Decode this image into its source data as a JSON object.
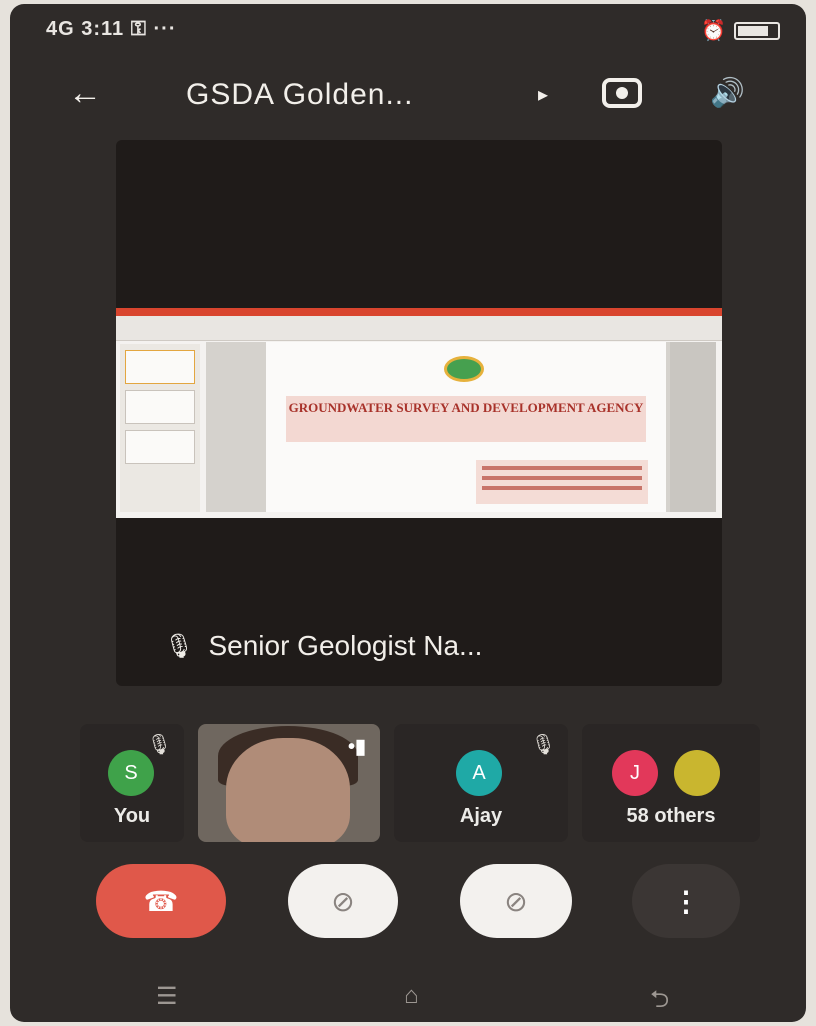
{
  "status_bar": {
    "left": "4G 3:11 ⚿  ···",
    "right_icon": "battery-icon"
  },
  "app_bar": {
    "back_icon": "back-arrow-icon",
    "title": "GSDA Golden...",
    "title_chevron": "▸",
    "switch_camera_icon": "switch-camera-icon",
    "speaker_icon": "speaker-icon"
  },
  "main_video": {
    "slide_heading": "GROUNDWATER SURVEY AND DEVELOPMENT AGENCY",
    "speaker_name": "Senior Geologist Na..."
  },
  "participants": [
    {
      "name": "You",
      "initial": "S",
      "color": "#3fa24a"
    },
    {
      "name": "camera-feed"
    },
    {
      "name": "Ajay",
      "initial": "A",
      "color": "#1fa9a6"
    },
    {
      "name": "58 others",
      "initial": "J",
      "color": "#e2385a",
      "second_color": "#c9b62f"
    }
  ],
  "controls": {
    "end_call_icon": "end-call-icon",
    "camera_icon": "camera-off-icon",
    "mic_icon": "mic-off-icon",
    "more_icon": "more-vert-icon"
  },
  "nav_bar": {
    "recent": "☰",
    "home": "⌂",
    "back": "⮌"
  }
}
